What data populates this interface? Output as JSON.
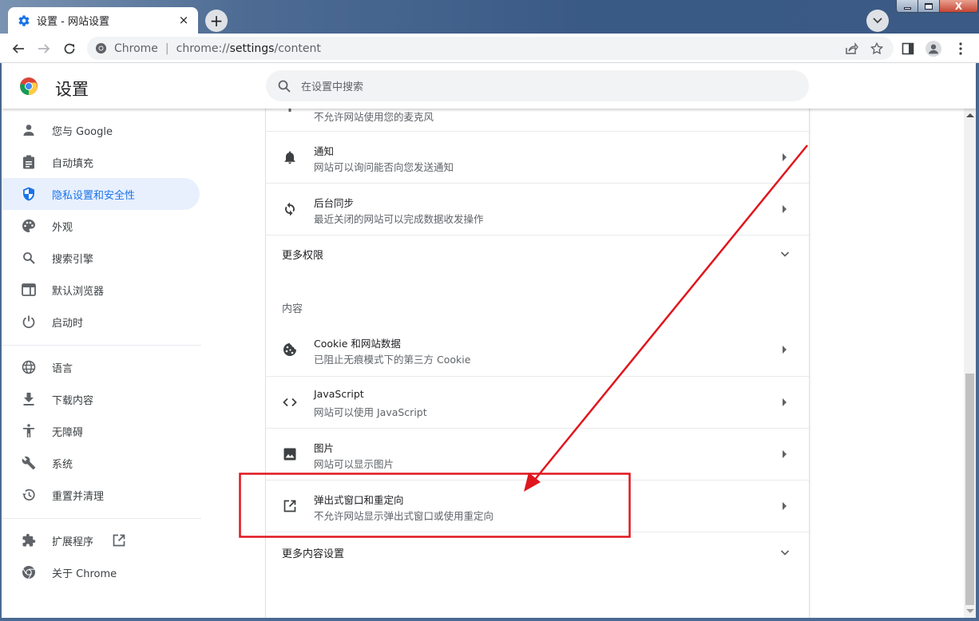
{
  "browser": {
    "tab_title": "设置 - 网站设置",
    "tab_close": "×",
    "new_tab": "+",
    "omnibox": {
      "site_label": "Chrome",
      "separator": "|",
      "url_prefix": "chrome://",
      "url_path": "settings",
      "url_suffix": "/content"
    },
    "window_close": "X"
  },
  "header": {
    "title": "设置",
    "search_placeholder": "在设置中搜索"
  },
  "sidebar": {
    "items": [
      {
        "label": "您与 Google",
        "icon": "person-icon"
      },
      {
        "label": "自动填充",
        "icon": "clipboard-icon"
      },
      {
        "label": "隐私设置和安全性",
        "icon": "shield-icon",
        "active": true
      },
      {
        "label": "外观",
        "icon": "palette-icon"
      },
      {
        "label": "搜索引擎",
        "icon": "search-icon"
      },
      {
        "label": "默认浏览器",
        "icon": "browser-icon"
      },
      {
        "label": "启动时",
        "icon": "power-icon"
      },
      {
        "label": "语言",
        "icon": "globe-icon"
      },
      {
        "label": "下载内容",
        "icon": "download-icon"
      },
      {
        "label": "无障碍",
        "icon": "accessibility-icon"
      },
      {
        "label": "系统",
        "icon": "wrench-icon"
      },
      {
        "label": "重置并清理",
        "icon": "history-icon"
      },
      {
        "label": "扩展程序",
        "icon": "puzzle-icon"
      },
      {
        "label": "关于 Chrome",
        "icon": "chrome-icon"
      }
    ]
  },
  "content": {
    "partial_row_subtitle": "不允许网站使用您的麦克风",
    "permission_rows": [
      {
        "title": "通知",
        "subtitle": "网站可以询问能否向您发送通知",
        "icon": "bell-icon"
      },
      {
        "title": "后台同步",
        "subtitle": "最近关闭的网站可以完成数据收发操作",
        "icon": "sync-icon"
      }
    ],
    "more_permissions": "更多权限",
    "content_section_title": "内容",
    "content_rows": [
      {
        "title": "Cookie 和网站数据",
        "subtitle": "已阻止无痕模式下的第三方 Cookie",
        "icon": "cookie-icon"
      },
      {
        "title": "JavaScript",
        "subtitle": "网站可以使用 JavaScript",
        "icon": "code-icon"
      },
      {
        "title": "图片",
        "subtitle": "网站可以显示图片",
        "icon": "image-icon"
      },
      {
        "title": "弹出式窗口和重定向",
        "subtitle": "不允许网站显示弹出式窗口或使用重定向",
        "icon": "open-in-new-icon"
      }
    ],
    "more_content_settings": "更多内容设置"
  },
  "annotation": {
    "color": "#e0161e",
    "highlighted_item": "弹出式窗口和重定向"
  }
}
